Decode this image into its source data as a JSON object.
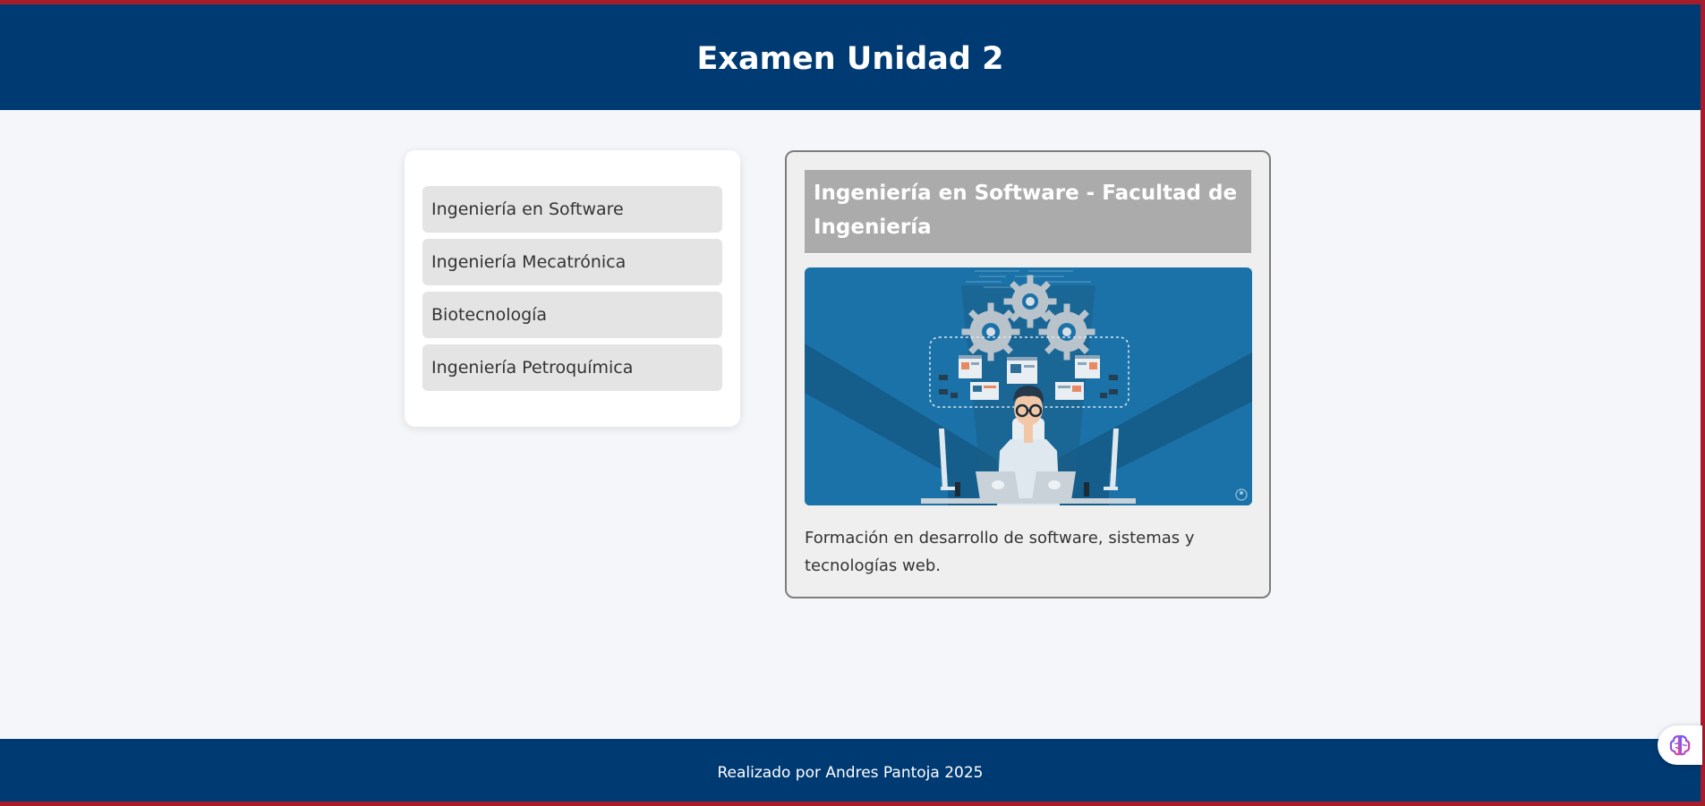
{
  "header": {
    "title": "Examen Unidad 2"
  },
  "menu": {
    "items": [
      {
        "label": "Ingeniería en Software"
      },
      {
        "label": "Ingeniería Mecatrónica"
      },
      {
        "label": "Biotecnología"
      },
      {
        "label": "Ingeniería Petroquímica"
      }
    ]
  },
  "detail": {
    "title": "Ingeniería en Software - Facultad de Ingeniería",
    "image_icon": "software-engineer-illustration",
    "description": "Formación en desarrollo de software, sistemas y tecnologías web."
  },
  "footer": {
    "text": "Realizado por Andres Pantoja 2025"
  },
  "widget": {
    "icon": "brain-icon"
  },
  "colors": {
    "header_bg": "#003a73",
    "page_bg": "#f4f6fa",
    "menu_item_bg": "#e4e4e4",
    "detail_title_bg": "#ababab",
    "image_bg": "#1b72a8",
    "frame_border": "#a51d2a"
  }
}
